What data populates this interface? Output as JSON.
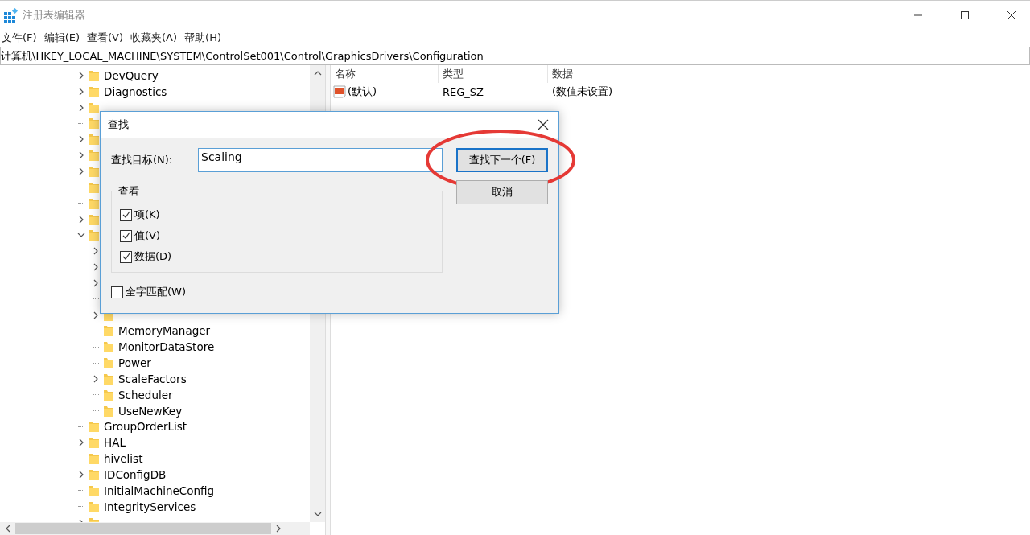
{
  "window": {
    "title": "注册表编辑器"
  },
  "menu": [
    "文件(F)",
    "编辑(E)",
    "查看(V)",
    "收藏夹(A)",
    "帮助(H)"
  ],
  "address": "计算机\\HKEY_LOCAL_MACHINE\\SYSTEM\\ControlSet001\\Control\\GraphicsDrivers\\Configuration",
  "tree": [
    {
      "name": "DevQuery",
      "expandable": true,
      "expanded": false
    },
    {
      "name": "Diagnostics",
      "expandable": true,
      "expanded": false
    },
    {
      "expandable": true,
      "expanded": false
    },
    {
      "expandable": false
    },
    {
      "expandable": true,
      "expanded": false
    },
    {
      "expandable": true,
      "expanded": false
    },
    {
      "expandable": true,
      "expanded": false
    },
    {
      "expandable": false
    },
    {
      "expandable": false
    },
    {
      "expandable": true,
      "expanded": false
    },
    {
      "expandable": true,
      "expanded": true,
      "children": [
        {
          "expandable": true,
          "expanded": false
        },
        {
          "expandable": true,
          "expanded": false
        },
        {
          "expandable": true,
          "expanded": false
        },
        {
          "expandable": false
        },
        {
          "expandable": true,
          "expanded": false
        },
        {
          "name": "MemoryManager",
          "expandable": false
        },
        {
          "name": "MonitorDataStore",
          "expandable": false
        },
        {
          "name": "Power",
          "expandable": false
        },
        {
          "name": "ScaleFactors",
          "expandable": true,
          "expanded": false
        },
        {
          "name": "Scheduler",
          "expandable": false
        },
        {
          "name": "UseNewKey",
          "expandable": false
        }
      ]
    },
    {
      "name": "GroupOrderList",
      "expandable": false
    },
    {
      "name": "HAL",
      "expandable": true,
      "expanded": false
    },
    {
      "name": "hivelist",
      "expandable": false
    },
    {
      "name": "IDConfigDB",
      "expandable": true,
      "expanded": false
    },
    {
      "name": "InitialMachineConfig",
      "expandable": false
    },
    {
      "name": "IntegrityServices",
      "expandable": false
    },
    {
      "expandable": true,
      "expanded": false
    }
  ],
  "values": {
    "columns": [
      "名称",
      "类型",
      "数据"
    ],
    "rows": [
      {
        "name": "(默认)",
        "type": "REG_SZ",
        "data": "(数值未设置)"
      }
    ]
  },
  "dialog": {
    "title": "查找",
    "find_label": "查找目标(N):",
    "find_value": "Scaling",
    "group_label": "查看",
    "options": [
      {
        "label": "项(K)",
        "checked": true
      },
      {
        "label": "值(V)",
        "checked": true
      },
      {
        "label": "数据(D)",
        "checked": true
      }
    ],
    "match_whole": {
      "label": "全字匹配(W)",
      "checked": false
    },
    "buttons": [
      {
        "label": "查找下一个(F)",
        "default": true,
        "circled": true
      },
      {
        "label": "取消",
        "default": false,
        "circled": false
      }
    ]
  }
}
